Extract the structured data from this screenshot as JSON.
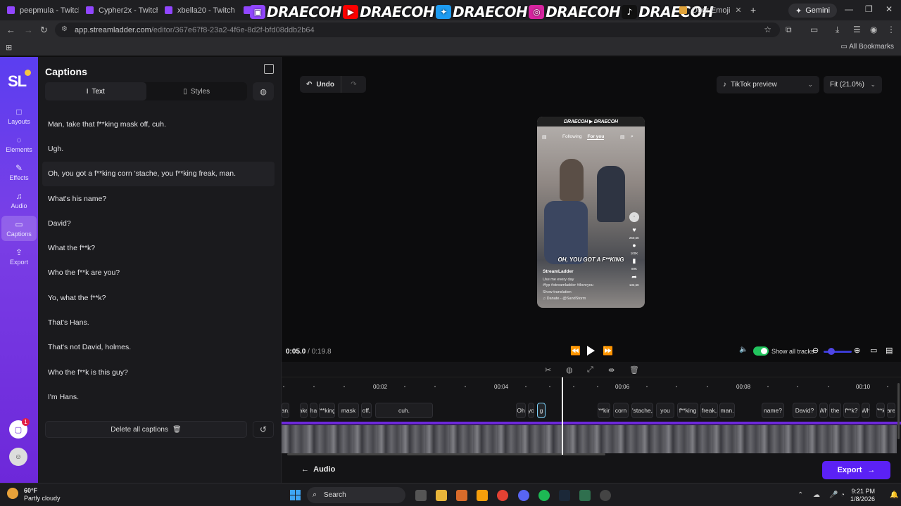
{
  "browser": {
    "tabs": [
      {
        "label": "peepmula - Twitch"
      },
      {
        "label": "Cypher2x - Twitch"
      },
      {
        "label": "xbella20 - Twitch"
      },
      {
        "label": "m"
      },
      {
        "label": ""
      },
      {
        "label": ""
      },
      {
        "label": ""
      },
      {
        "label": "Door Emoji"
      }
    ],
    "banner": {
      "text1": "DRAECOH",
      "text2": "DRAECOH",
      "text3": "DRAECOH",
      "text4": "DRAECOH",
      "text5": "DRAECOH"
    },
    "gemini_label": "Gemini",
    "url": "app.streamladder.com",
    "url_path": "/editor/367e67f8-23a2-4f6e-8d2f-bfd08ddb2b64",
    "all_bookmarks": "All Bookmarks"
  },
  "rail": {
    "logo": "SL",
    "items": [
      {
        "label": "Layouts",
        "icon": "□"
      },
      {
        "label": "Elements",
        "icon": "◌"
      },
      {
        "label": "Effects",
        "icon": "✎"
      },
      {
        "label": "Audio",
        "icon": "♫"
      },
      {
        "label": "Captions",
        "icon": "▭"
      },
      {
        "label": "Export",
        "icon": "⇪"
      }
    ],
    "notification_count": "1"
  },
  "captions_panel": {
    "title": "Captions",
    "tab_text": "Text",
    "tab_styles": "Styles",
    "captions": [
      "Man, take that f**king mask off, cuh.",
      "Ugh.",
      "Oh, you got a f**king corn 'stache, you f**king freak, man.",
      "What's his name?",
      "David?",
      "What the f**k?",
      "Who the f**k are you?",
      "Yo, what the f**k?",
      "That's Hans.",
      "That's not David, holmes.",
      "Who the f**k is this guy?",
      "I'm Hans."
    ],
    "delete_all": "Delete all captions"
  },
  "stage": {
    "undo": "Undo",
    "preview_select": "TikTok preview",
    "fit_select": "Fit (21.0%)",
    "phone": {
      "banner": "DRAECOH ▶ DRAECOH",
      "tab_following": "Following",
      "tab_for_you": "For you",
      "caption": "OH, YOU GOT A F**KING",
      "username": "StreamLadder",
      "line1": "Use me every day",
      "line2": "#fyp #streamladder #iloveyou",
      "line3": "Show translation",
      "line4": "♫ Danate - @SandStorm",
      "likes": "250,5K",
      "comments": "100K",
      "saves": "89K",
      "shares": "132,5K"
    }
  },
  "transport": {
    "current": "0:05.0",
    "separator": "/",
    "total": "0:19.8",
    "show_all_tracks": "Show all tracks"
  },
  "timeline": {
    "ticks": [
      "00:02",
      "00:04",
      "00:06",
      "00:08",
      "00:10"
    ],
    "chips": [
      {
        "text": "an."
      },
      {
        "text": "ake"
      },
      {
        "text": "ha"
      },
      {
        "text": "f**king"
      },
      {
        "text": "mask"
      },
      {
        "text": "off,"
      },
      {
        "text": "cuh."
      },
      {
        "text": "Oh"
      },
      {
        "text": "yo"
      },
      {
        "text": "g"
      },
      {
        "text": "f**kin"
      },
      {
        "text": "corn"
      },
      {
        "text": "'stache,"
      },
      {
        "text": "you"
      },
      {
        "text": "f**king"
      },
      {
        "text": "freak,"
      },
      {
        "text": "man."
      },
      {
        "text": "name?"
      },
      {
        "text": "David?"
      },
      {
        "text": "Wh"
      },
      {
        "text": "the"
      },
      {
        "text": "f**k?"
      },
      {
        "text": "Wh"
      },
      {
        "text": "f**k"
      },
      {
        "text": "are"
      }
    ]
  },
  "bottom": {
    "audio": "Audio",
    "export": "Export"
  },
  "taskbar": {
    "temp": "60°F",
    "weather": "Partly cloudy",
    "search": "Search",
    "time": "9:21 PM",
    "date": "1/8/2026"
  }
}
